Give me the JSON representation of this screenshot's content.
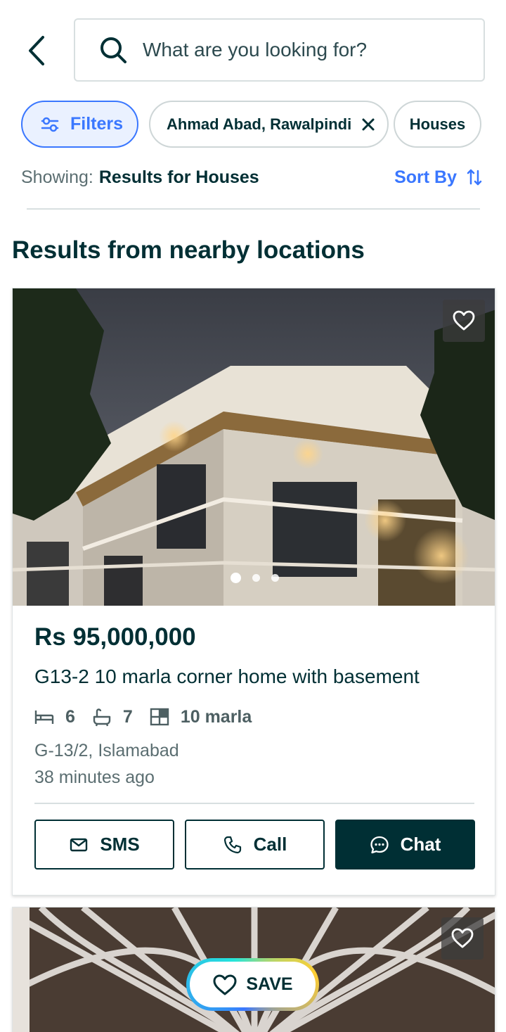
{
  "search": {
    "placeholder": "What are you looking for?"
  },
  "chips": {
    "filters_label": "Filters",
    "location_label": "Ahmad Abad, Rawalpindi",
    "category_label": "Houses"
  },
  "results_header": {
    "showing_label": "Showing:",
    "showing_value": "Results for Houses",
    "sort_label": "Sort By"
  },
  "section_title": "Results from nearby locations",
  "listings": [
    {
      "price": "Rs 95,000,000",
      "title": "G13-2 10 marla corner home with basement",
      "beds": "6",
      "baths": "7",
      "area": "10 marla",
      "location": "G-13/2, Islamabad",
      "posted": "38 minutes ago",
      "image_count": 3,
      "active_image": 1
    }
  ],
  "actions": {
    "sms_label": "SMS",
    "call_label": "Call",
    "chat_label": "Chat"
  },
  "save_button": {
    "label": "SAVE"
  },
  "colors": {
    "primary_dark": "#002f34",
    "accent_blue": "#3a77ff",
    "filter_bg": "#eaf1ff",
    "muted_text": "#5b6e71",
    "divider": "#d8dfe0"
  },
  "icons": [
    "chevron-left-icon",
    "search-icon",
    "sliders-icon",
    "close-icon",
    "sort-icon",
    "heart-icon",
    "bed-icon",
    "bath-icon",
    "area-icon",
    "mail-icon",
    "phone-icon",
    "chat-bubble-icon"
  ]
}
